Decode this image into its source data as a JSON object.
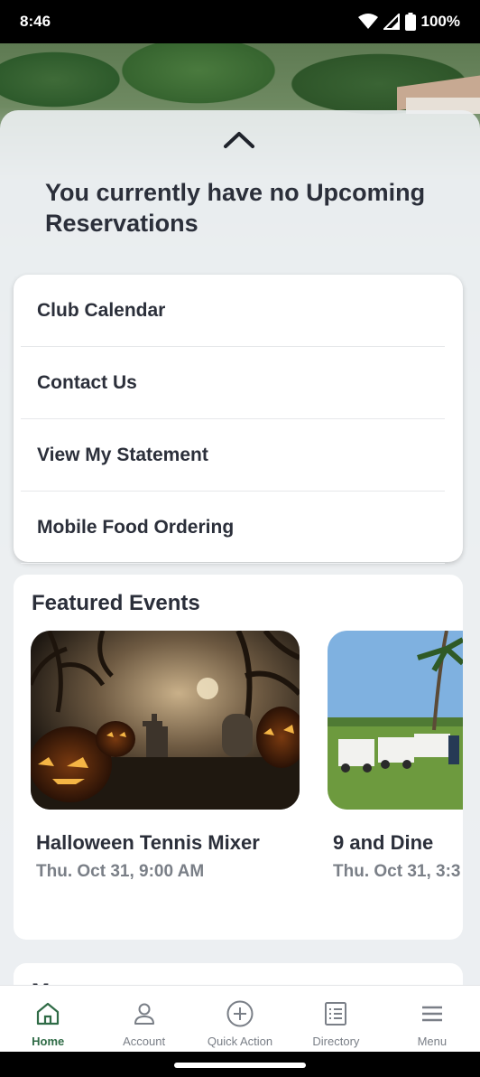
{
  "status_bar": {
    "time": "8:46",
    "battery": "100%"
  },
  "upcoming": {
    "message": "You currently have no Upcoming Reservations"
  },
  "quick_links": [
    {
      "label": "Club Calendar"
    },
    {
      "label": "Contact Us"
    },
    {
      "label": "View My Statement"
    },
    {
      "label": "Mobile Food Ordering"
    }
  ],
  "featured_events": {
    "title": "Featured Events",
    "events": [
      {
        "name": "Halloween Tennis Mixer",
        "date": "Thu. Oct 31, 9:00 AM"
      },
      {
        "name": "9 and Dine",
        "date": "Thu. Oct 31, 3:3"
      }
    ]
  },
  "next_section": {
    "title": "M"
  },
  "bottom_nav": [
    {
      "label": "Home",
      "icon": "home-icon",
      "active": true
    },
    {
      "label": "Account",
      "icon": "account-icon",
      "active": false
    },
    {
      "label": "Quick Action",
      "icon": "plus-circle-icon",
      "active": false
    },
    {
      "label": "Directory",
      "icon": "directory-icon",
      "active": false
    },
    {
      "label": "Menu",
      "icon": "hamburger-icon",
      "active": false
    }
  ],
  "colors": {
    "active_nav": "#2f6b46",
    "inactive_nav": "#7a7f87",
    "heading": "#2b2f3a"
  }
}
